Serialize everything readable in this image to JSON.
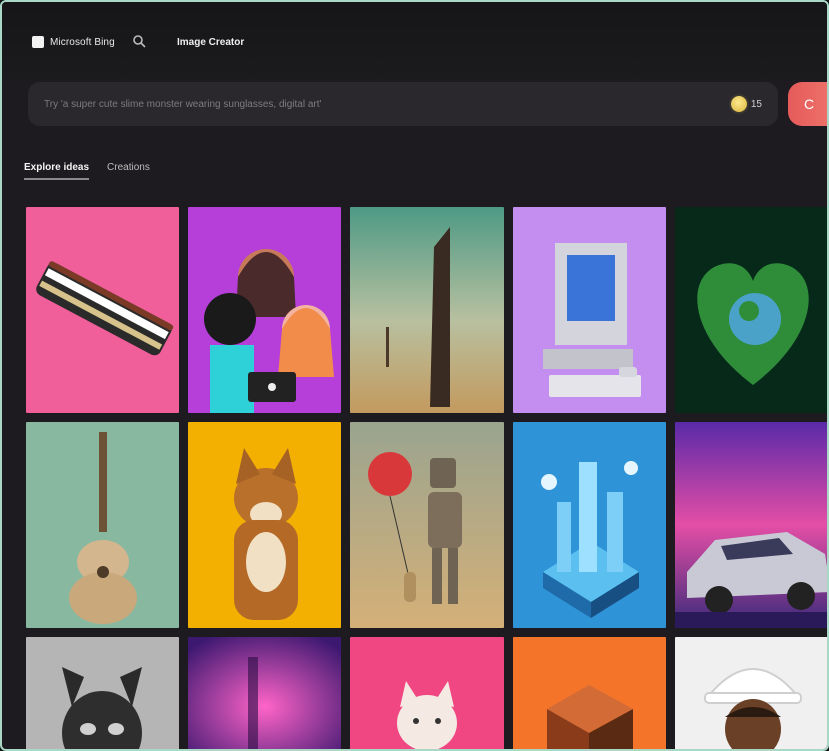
{
  "header": {
    "brand": "Microsoft Bing",
    "title": "Image Creator",
    "search_icon": "search-icon",
    "logo_icon": "microsoft-logo-icon"
  },
  "prompt": {
    "placeholder": "Try 'a super cute slime monster wearing sunglasses, digital art'",
    "boost_count": "15",
    "create_label": "C"
  },
  "tabs": [
    {
      "label": "Explore ideas",
      "active": true
    },
    {
      "label": "Creations",
      "active": false
    }
  ],
  "gallery": [
    {
      "name": "striped-bracelet-on-pink",
      "bg": "#f05f9a"
    },
    {
      "name": "cartoon-friends-laptop",
      "bg": "#b63fda"
    },
    {
      "name": "desert-tower",
      "bg": "#9ab89f"
    },
    {
      "name": "retro-computer-purple",
      "bg": "#c48ef0"
    },
    {
      "name": "green-heart-earth",
      "bg": "#09331e"
    },
    {
      "name": "ornate-guitar",
      "bg": "#88b9a0"
    },
    {
      "name": "shiba-dog-yellow",
      "bg": "#f4b000"
    },
    {
      "name": "robot-with-balloon",
      "bg": "#cfa56f"
    },
    {
      "name": "isometric-city-blue",
      "bg": "#2f93d8"
    },
    {
      "name": "retro-car-sunset",
      "bg": "#e44ea6"
    },
    {
      "name": "horned-mask",
      "bg": "#b5b5b5"
    },
    {
      "name": "purple-stage",
      "bg": "#8b2fd0"
    },
    {
      "name": "cat-pink",
      "bg": "#f04681"
    },
    {
      "name": "orange-gift-box",
      "bg": "#f4742a"
    },
    {
      "name": "person-white-hat",
      "bg": "#f0f0f0"
    }
  ]
}
